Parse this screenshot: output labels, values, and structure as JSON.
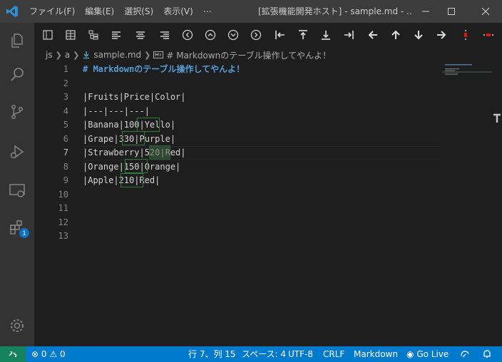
{
  "titlebar": {
    "menu": [
      "ファイル(F)",
      "編集(E)",
      "選択(S)",
      "表示(V)",
      "⋯"
    ],
    "title": "[拡張機能開発ホスト] - sample.md - ..."
  },
  "activity": {
    "badge": "1"
  },
  "breadcrumb": {
    "items": [
      "js",
      "a",
      "sample.md",
      "# Markdownのテーブル操作してやんよ！"
    ]
  },
  "editor": {
    "line_numbers": [
      "1",
      "2",
      "3",
      "4",
      "5",
      "6",
      "7",
      "8",
      "9",
      "10",
      "11",
      "12",
      "13"
    ],
    "active_line": 7,
    "lines": [
      "# Markdownのテーブル操作してやんよ！",
      "",
      "|Fruits|Price|Color|",
      "|---|---|---|",
      "|Banana|100|Yello|",
      "|Grape|330|Purple|",
      "|Strawberry|520|Red|",
      "|Orange|150|Orange|",
      "|Apple|210|Red|",
      "",
      "",
      "",
      ""
    ]
  },
  "statusbar": {
    "errors": "0",
    "warnings": "0",
    "position": "行 7、列 15",
    "spaces": "スペース: 4",
    "encoding": "UTF-8",
    "eol": "CRLF",
    "language": "Markdown",
    "golive": "Go Live"
  },
  "colors": {
    "accent": "#007acc",
    "remote": "#16825d",
    "heading": "#569cd6",
    "cell_highlight": "#3f6742"
  }
}
